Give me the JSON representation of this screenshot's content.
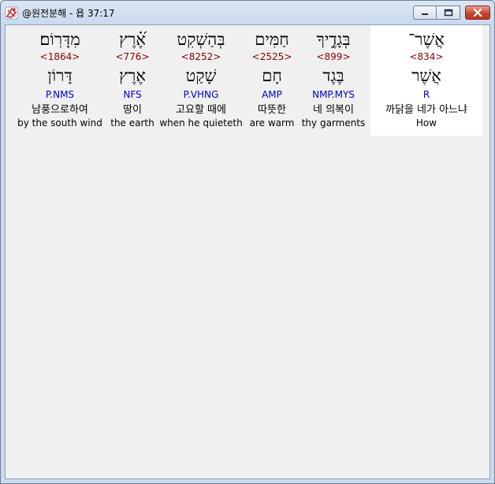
{
  "window": {
    "title": "@원전분해 - 욥 37:17",
    "controls": [
      "minimize",
      "maximize",
      "close"
    ]
  },
  "words": [
    {
      "hebrew": "מִדָּרֽוֹם׃",
      "strong": "<1864>",
      "root": "דָּרוֹן",
      "morph": "P.NMS",
      "korean": "남풍으로하여",
      "english": "by the south wind",
      "selected": false
    },
    {
      "hebrew": "אֶ֝֗רֶץ",
      "strong": "<776>",
      "root": "אֶרֶץ",
      "morph": "NFS",
      "korean": "땅이",
      "english": "the earth",
      "selected": false
    },
    {
      "hebrew": "בְּהַשְׁקִט",
      "strong": "<8252>",
      "root": "שָׁקַט",
      "morph": "P.VHNG",
      "korean": "고요할 때에",
      "english": "when he quieteth",
      "selected": false
    },
    {
      "hebrew": "חַמִּים",
      "strong": "<2525>",
      "root": "חָם",
      "morph": "AMP",
      "korean": "따뜻한",
      "english": "are warm",
      "selected": false
    },
    {
      "hebrew": "בְּגָדֶ֣יךָ",
      "strong": "<899>",
      "root": "בֶּגֶד",
      "morph": "NMP.MYS",
      "korean": "네 의복이",
      "english": "thy garments",
      "selected": false
    },
    {
      "hebrew": "אֲשֶׁר־",
      "strong": "<834>",
      "root": "אֲשֶׁר",
      "morph": "R",
      "korean": "까닭을 네가 아느냐",
      "english": "How",
      "selected": true
    }
  ]
}
